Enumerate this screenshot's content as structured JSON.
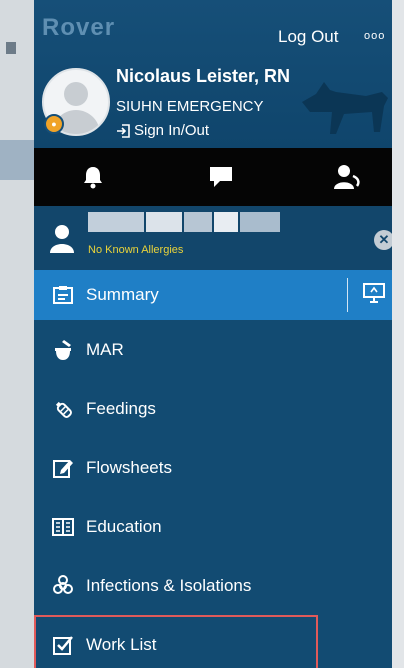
{
  "app": {
    "logo_text": "Rover",
    "logout_label": "Log Out",
    "more_label": "ooo"
  },
  "user": {
    "name": "Nicolaus Leister, RN",
    "department": "SIUHN EMERGENCY",
    "sign_in_label": "Sign In/Out"
  },
  "toolbar": {
    "icons": [
      "bell-icon",
      "chat-bubble-icon",
      "user-headset-icon"
    ]
  },
  "patient": {
    "allergies": "No Known Allergies"
  },
  "menu": {
    "items": [
      {
        "label": "Summary",
        "icon": "clipboard-icon",
        "active": true
      },
      {
        "label": "MAR",
        "icon": "mortar-pestle-icon"
      },
      {
        "label": "Feedings",
        "icon": "bottle-icon"
      },
      {
        "label": "Flowsheets",
        "icon": "edit-sheet-icon"
      },
      {
        "label": "Education",
        "icon": "book-icon"
      },
      {
        "label": "Infections & Isolations",
        "icon": "biohazard-icon"
      },
      {
        "label": "Work List",
        "icon": "checkbox-icon",
        "highlighted": true
      }
    ]
  },
  "colors": {
    "panel": "#124b72",
    "active": "#1f7fc6",
    "toolbar": "#050505",
    "allergy_text": "#e9d33a",
    "highlight_box": "#e05a5a"
  }
}
